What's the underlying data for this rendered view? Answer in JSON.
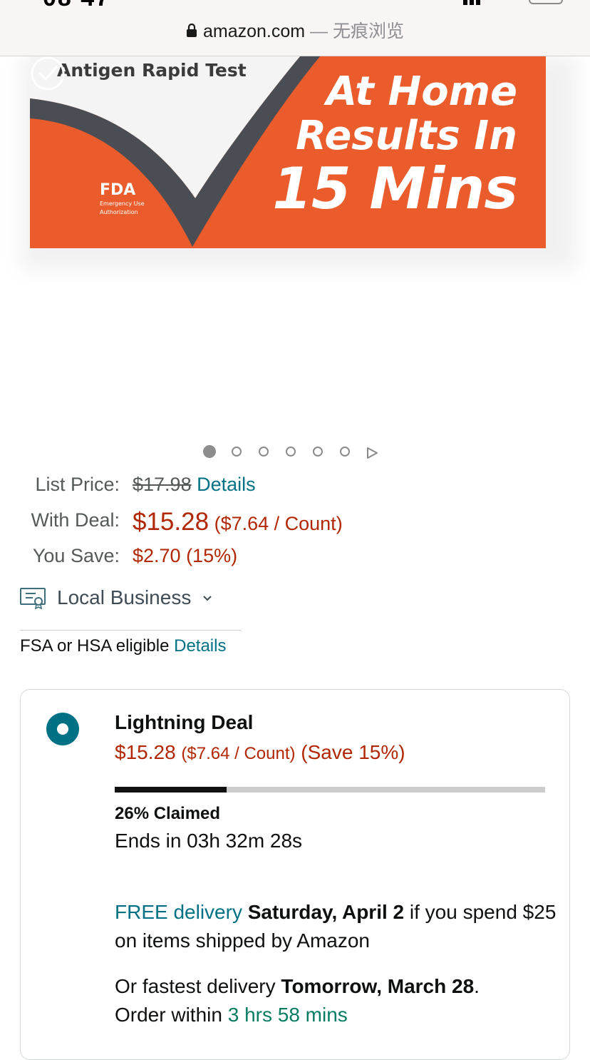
{
  "browser": {
    "url_domain": "amazon.com",
    "url_suffix": " — 无痕浏览"
  },
  "product_image": {
    "subtitle": "Antigen Rapid Test",
    "badge_title": "FDA",
    "badge_sub_1": "Emergency Use",
    "badge_sub_2": "Authorization",
    "headline_1": "At Home",
    "headline_2": "Results In",
    "headline_3": "15 Mins",
    "accent_color": "#ea5c2b"
  },
  "carousel": {
    "total_dots": 6,
    "active_index": 0
  },
  "pricing": {
    "list_price_label": "List Price:",
    "list_price": "$17.98",
    "details_link": "Details",
    "with_deal_label": "With Deal:",
    "deal_price": "$15.28",
    "deal_unit": "($7.64 / Count)",
    "you_save_label": "You Save:",
    "you_save": "$2.70 (15%)"
  },
  "business": {
    "label": "Local Business"
  },
  "fsa": {
    "text": "FSA or HSA eligible",
    "link": "Details"
  },
  "deal_card": {
    "title": "Lightning Deal",
    "price": "$15.28",
    "unit": "($7.64 / Count)",
    "save": "(Save 15%)",
    "claimed_fraction": 0.26,
    "claimed_text": "26% Claimed",
    "ends_text": "Ends in 03h 32m 28s",
    "free_delivery": "FREE delivery",
    "delivery_date": "Saturday, April 2",
    "delivery_rest": "if you spend $25 on items shipped by Amazon",
    "fastest_prefix": "Or fastest delivery",
    "fastest_date": "Tomorrow, March 28",
    "fastest_period": ".",
    "order_within": "Order within",
    "countdown": "3 hrs 58 mins"
  }
}
